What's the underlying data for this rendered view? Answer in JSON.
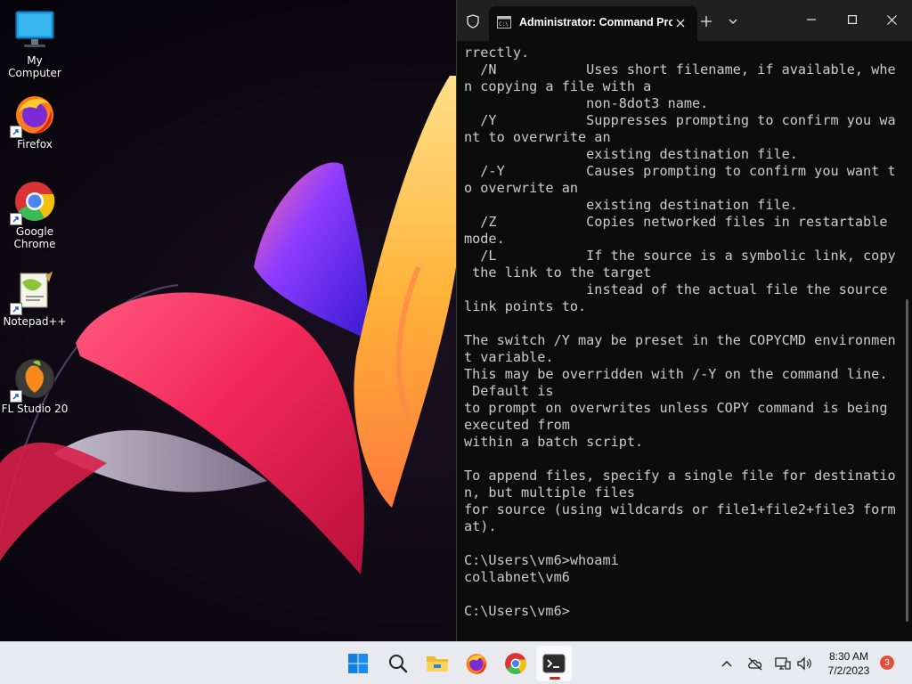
{
  "desktop": {
    "icons": [
      {
        "label": "My Computer",
        "icon": "monitor-icon"
      },
      {
        "label": "Firefox",
        "icon": "firefox-icon"
      },
      {
        "label": "Google Chrome",
        "icon": "chrome-icon"
      },
      {
        "label": "Notepad++",
        "icon": "notepadpp-icon"
      },
      {
        "label": "FL Studio 20",
        "icon": "flstudio-icon"
      }
    ]
  },
  "terminal": {
    "tab_title": "Administrator: Command Prompt",
    "lines": [
      "rrectly.",
      "  /N           Uses short filename, if available, whe",
      "n copying a file with a",
      "               non-8dot3 name.",
      "  /Y           Suppresses prompting to confirm you wa",
      "nt to overwrite an",
      "               existing destination file.",
      "  /-Y          Causes prompting to confirm you want t",
      "o overwrite an",
      "               existing destination file.",
      "  /Z           Copies networked files in restartable",
      "mode.",
      "  /L           If the source is a symbolic link, copy",
      " the link to the target",
      "               instead of the actual file the source",
      "link points to.",
      "",
      "The switch /Y may be preset in the COPYCMD environmen",
      "t variable.",
      "This may be overridden with /-Y on the command line.",
      " Default is",
      "to prompt on overwrites unless COPY command is being",
      "executed from",
      "within a batch script.",
      "",
      "To append files, specify a single file for destinatio",
      "n, but multiple files",
      "for source (using wildcards or file1+file2+file3 form",
      "at).",
      "",
      "C:\\Users\\vm6>whoami",
      "collabnet\\vm6",
      "",
      "C:\\Users\\vm6>"
    ]
  },
  "taskbar": {
    "apps": [
      "start-icon",
      "search-icon",
      "file-explorer-icon",
      "firefox-icon",
      "chrome-icon",
      "terminal-icon"
    ],
    "clock_time": "8:30 AM",
    "clock_date": "7/2/2023",
    "notification_count": "3"
  },
  "colors": {
    "terminal_bg": "#0c0c0c",
    "terminal_text": "#cccccc",
    "titlebar_bg": "#202020",
    "taskbar_bg": "#e9eaef",
    "notification_badge": "#e0503a"
  }
}
